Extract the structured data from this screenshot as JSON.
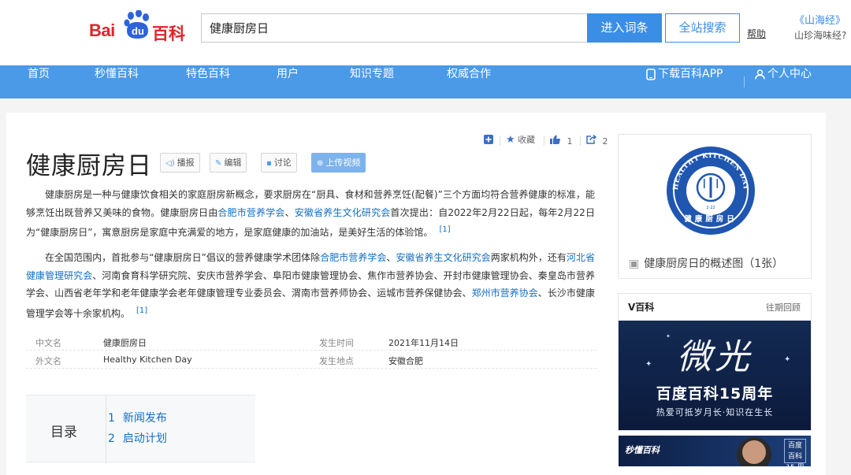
{
  "header": {
    "logo_bai": "Bai",
    "logo_du": "du",
    "logo_baike": "百科",
    "search_value": "健康厨房日",
    "enter_label": "进入词条",
    "search_all_label": "全站搜索",
    "help_label": "帮助",
    "promo_title": "《山海经》",
    "promo_sub": "山珍海味经?"
  },
  "nav": {
    "items": [
      "首页",
      "秒懂百科",
      "特色百科",
      "用户",
      "知识专题",
      "权威合作"
    ],
    "download_app": "下载百科APP",
    "personal_center": "个人中心"
  },
  "tools": {
    "collect_label": "收藏",
    "like_count": "1",
    "share_count": "2"
  },
  "article": {
    "title": "健康厨房日",
    "actions": {
      "broadcast": "播报",
      "edit": "编辑",
      "discuss": "讨论",
      "upload_video": "上传视频"
    },
    "para1": {
      "t1": "健康厨房是一种与健康饮食相关的家庭厨房新概念，要求厨房在“厨具、食材和营养烹饪(配餐)”三个方面均符合营养健康的标准，能够烹饪出既营养又美味的食物。健康厨房日由",
      "l1": "合肥市营养学会",
      "t2": "、",
      "l2": "安徽省养生文化研究会",
      "t3": "首次提出：自2022年2月22日起，每年2月22日为“健康厨房日”，寓意厨房是家庭中充满爱的地方，是家庭健康的加油站，是美好生活的体验馆。",
      "ref": "[1]"
    },
    "para2": {
      "t1": "在全国范围内，首批参与“健康厨房日”倡议的营养健康学术团体除",
      "l1": "合肥市营养学会",
      "t2": "、",
      "l2": "安徽省养生文化研究会",
      "t3": "两家机构外，还有",
      "l3": "河北省健康管理研究会",
      "t4": "、河南食育科学研究院、安庆市营养学会、阜阳市健康管理协会、焦作市营养协会、开封市健康管理协会、秦皇岛市营养学会、山西省老年学和老年健康学会老年健康管理专业委员会、渭南市营养师协会、运城市营养保健协会、",
      "l4": "郑州市营养协会",
      "t5": "、长沙市健康管理学会等十余家机构。",
      "ref": "[1]"
    },
    "info": {
      "rows": [
        {
          "k1": "中文名",
          "v1": "健康厨房日",
          "k2": "发生时间",
          "v2": "2021年11月14日"
        },
        {
          "k1": "外文名",
          "v1": "Healthy Kitchen Day",
          "k2": "发生地点",
          "v2": "安徽合肥"
        }
      ]
    },
    "toc": {
      "label": "目录",
      "items": [
        {
          "num": "1",
          "text": "新闻发布"
        },
        {
          "num": "2",
          "text": "启动计划"
        }
      ]
    }
  },
  "sidebar": {
    "summary_caption": "健康厨房日的概述图（1张）",
    "logo_arc_text": "HEALTHY KITCHEN DAY",
    "logo_cn_text": "健康厨房日",
    "logo_date": "2·22",
    "vbaike_title": "V百科",
    "vbaike_more": "往期回顾",
    "banner_big": "微光",
    "banner_title": "百度百科15周年",
    "banner_sub": "热爱可抵岁月长·知识在生长",
    "banner2_logo": "秒懂百科",
    "banner2_badge": "百度百科 15 周年"
  },
  "colors": {
    "brand_red": "#e0242a",
    "brand_blue": "#3a8ee6",
    "nav_blue": "#4a9ae8",
    "link_blue": "#136ec2",
    "logo_ring_blue": "#1f56b0"
  }
}
